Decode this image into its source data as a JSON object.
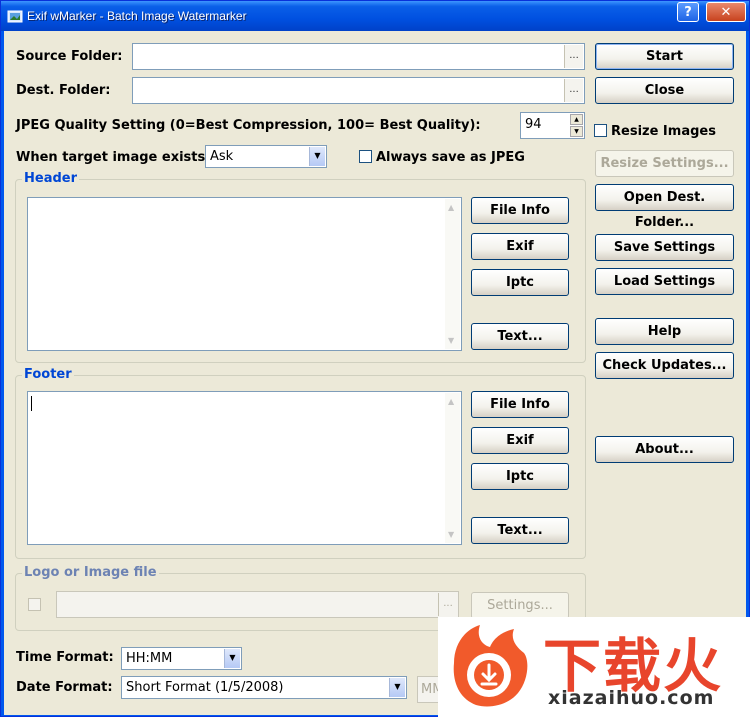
{
  "window": {
    "title": "Exif wMarker - Batch Image Watermarker",
    "help_button": "?",
    "close_button": "✕"
  },
  "source_folder": {
    "label": "Source Folder:",
    "value": "",
    "browse": "..."
  },
  "dest_folder": {
    "label": "Dest. Folder:",
    "value": "",
    "browse": "..."
  },
  "jpeg_quality": {
    "label": "JPEG Quality Setting (0=Best Compression, 100= Best Quality):",
    "value": "94"
  },
  "target_exists": {
    "label": "When target image exists:",
    "selected": "Ask"
  },
  "always_jpeg": {
    "label": "Always save as JPEG",
    "checked": false
  },
  "resize_images": {
    "label": "Resize Images",
    "checked": false
  },
  "header": {
    "title": "Header",
    "text": "",
    "buttons": {
      "file_info": "File Info",
      "exif": "Exif",
      "iptc": "Iptc",
      "text": "Text..."
    }
  },
  "footer": {
    "title": "Footer",
    "text": "",
    "buttons": {
      "file_info": "File Info",
      "exif": "Exif",
      "iptc": "Iptc",
      "text": "Text..."
    }
  },
  "logo": {
    "title": "Logo or Image file",
    "checked": false,
    "path": "",
    "browse": "...",
    "settings": "Settings..."
  },
  "time_format": {
    "label": "Time Format:",
    "selected": "HH:MM"
  },
  "date_format": {
    "label": "Date Format:",
    "selected": "Short Format (1/5/2008)",
    "extra": "MM"
  },
  "side_buttons": {
    "start": "Start",
    "close": "Close",
    "resize_settings": "Resize Settings...",
    "open_dest": "Open Dest. Folder...",
    "save_settings": "Save Settings",
    "load_settings": "Load Settings",
    "help": "Help",
    "check_updates": "Check Updates...",
    "about": "About..."
  },
  "watermark": {
    "chinese": "下载火",
    "site": "xiazaihuo.com"
  },
  "colors": {
    "accent": "#0046d5",
    "titlebar": "#0050e0",
    "watermark": "#e8452c"
  }
}
